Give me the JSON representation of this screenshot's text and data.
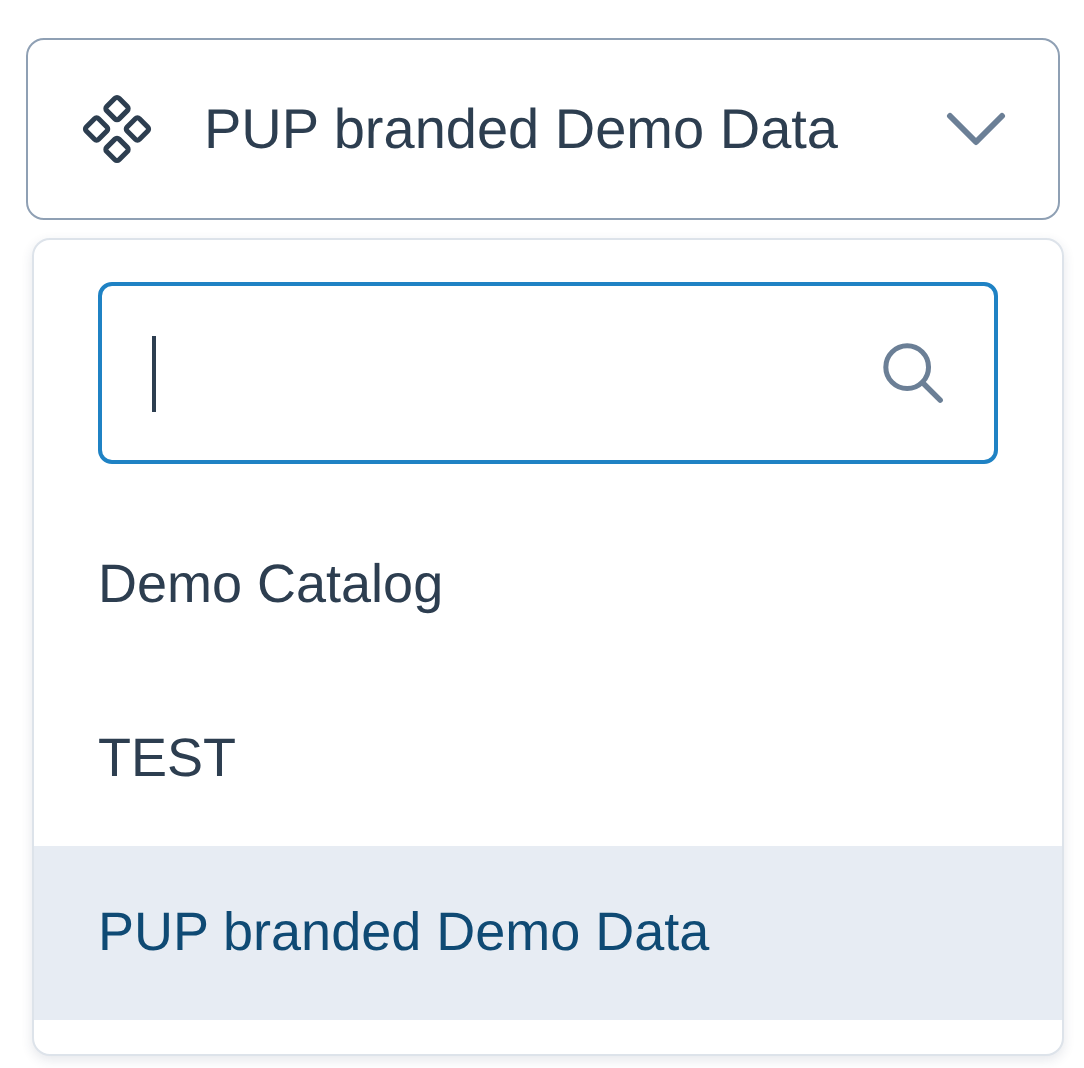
{
  "select": {
    "value": "PUP branded Demo Data"
  },
  "search": {
    "focused": true
  },
  "options": [
    {
      "label": "Demo Catalog",
      "selected": false
    },
    {
      "label": "TEST",
      "selected": false
    },
    {
      "label": "PUP branded Demo Data",
      "selected": true
    }
  ]
}
